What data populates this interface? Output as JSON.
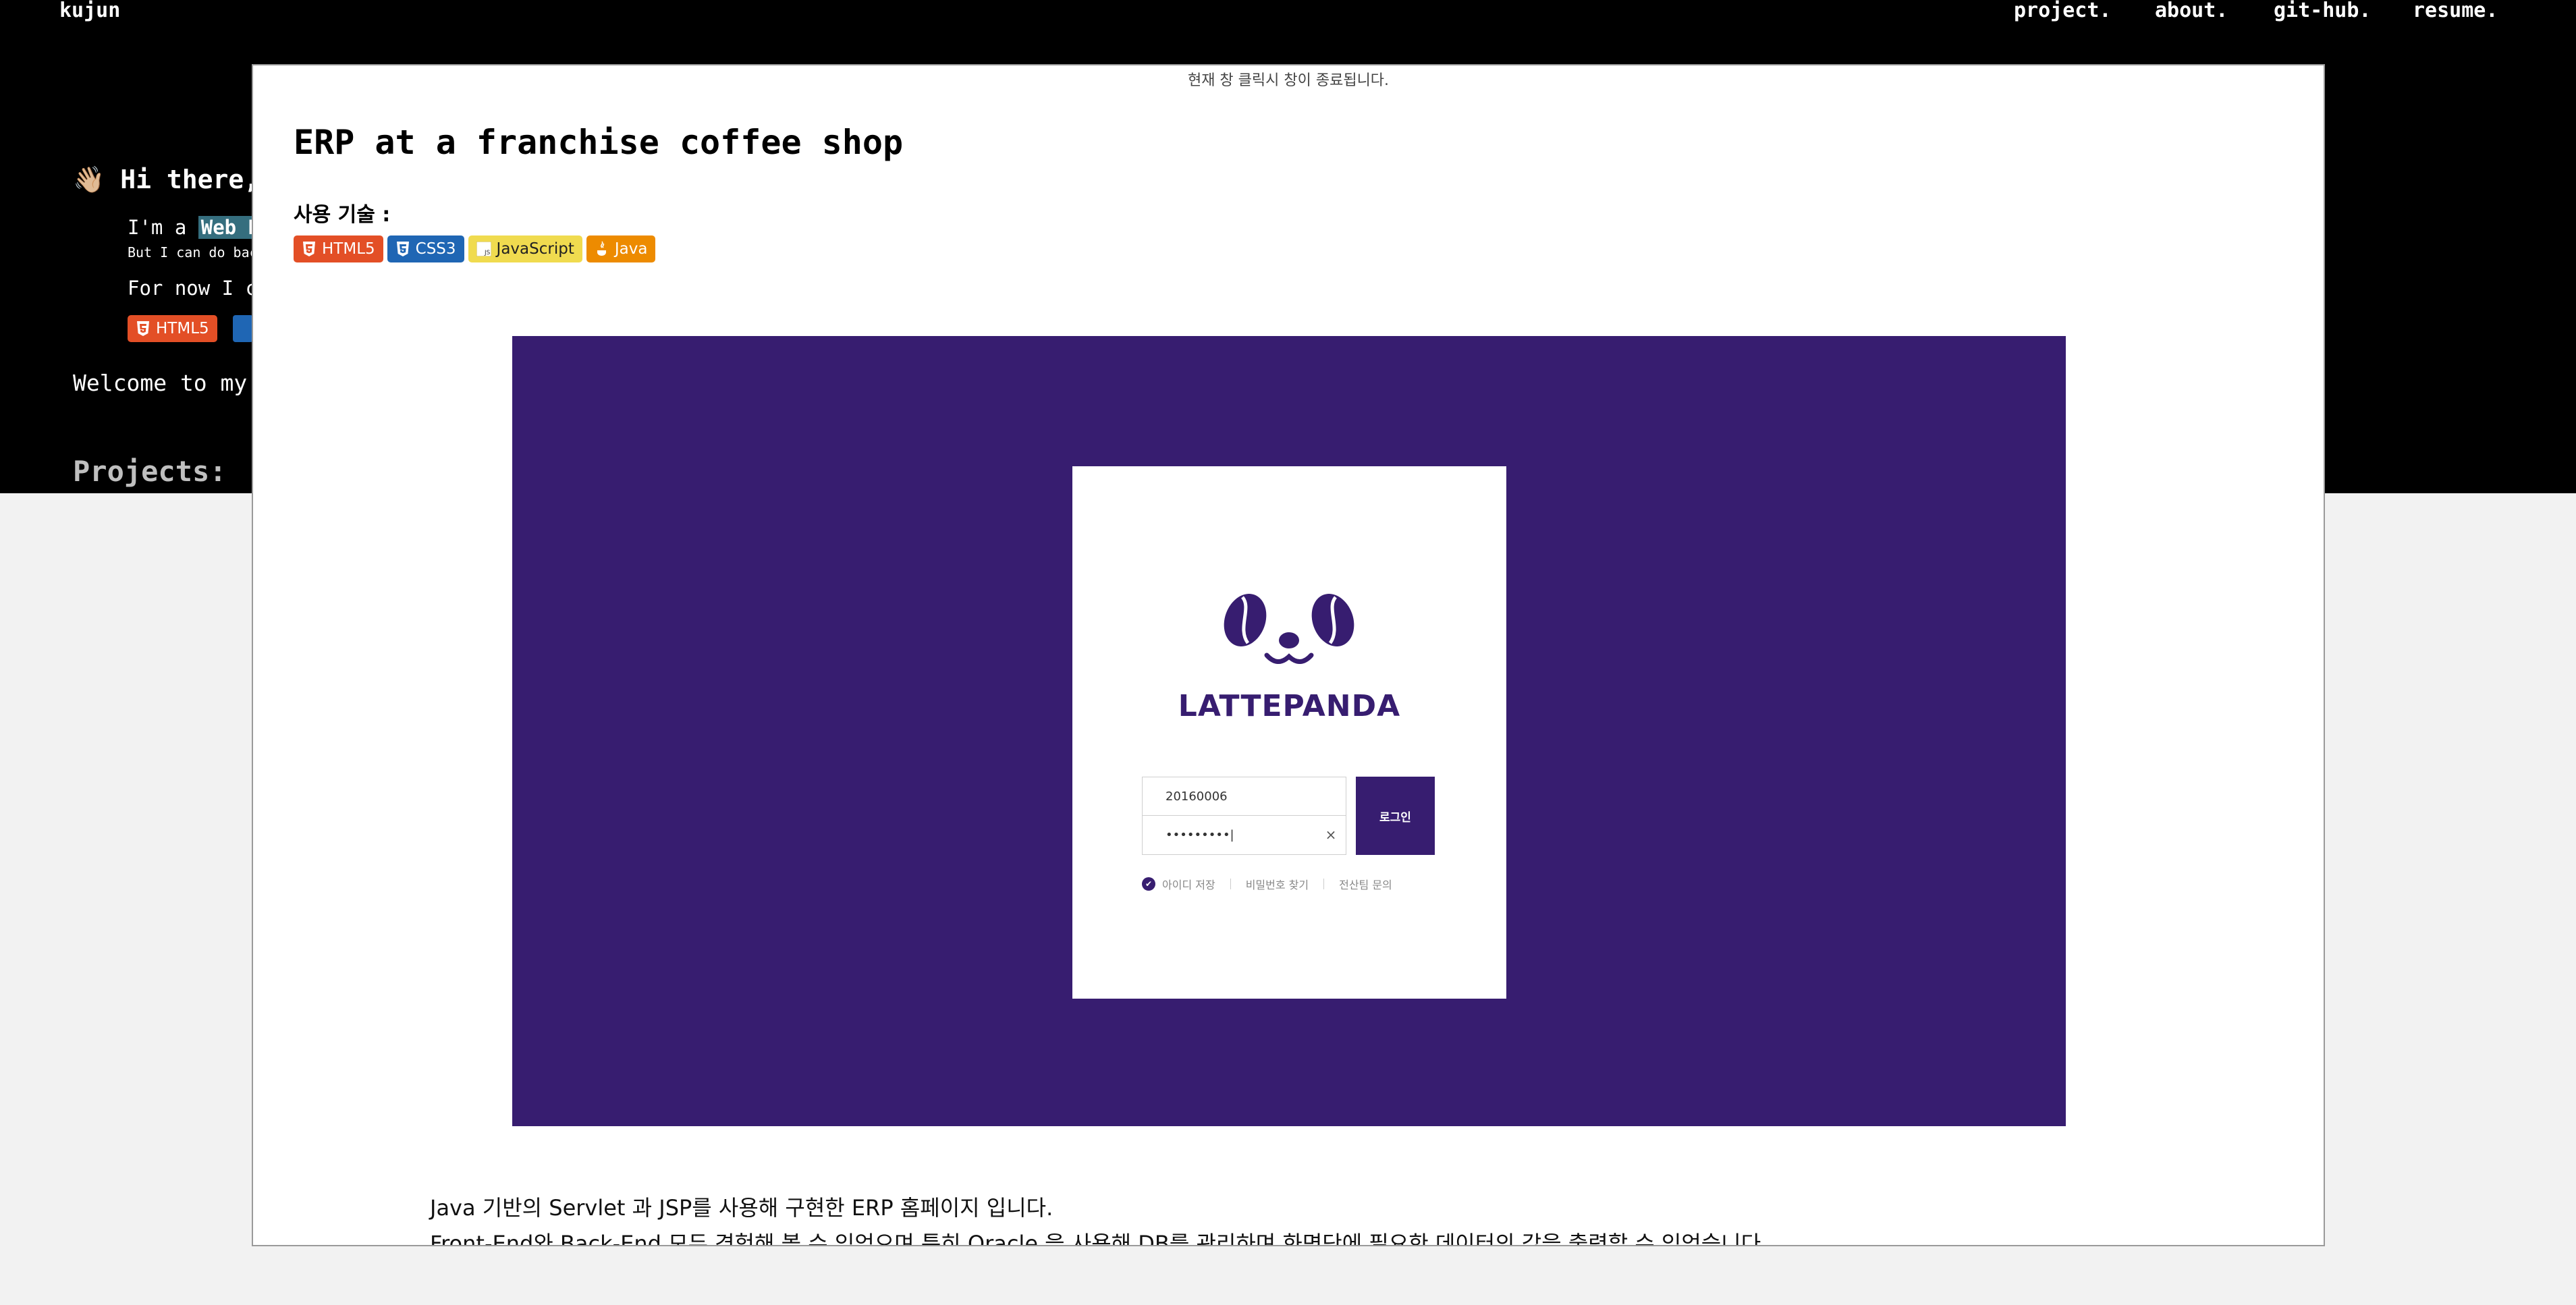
{
  "site": {
    "title": "kujun",
    "nav": [
      "project.",
      "about.",
      "git-hub.",
      "resume."
    ]
  },
  "background": {
    "greeting_emoji": "👋🏼",
    "greeting": "Hi there,",
    "intro_prefix": "I'm a ",
    "intro_highlight": "Web De",
    "intro_small": "But I can do bac",
    "for_now": "For now I ca",
    "badge_html": "HTML5",
    "welcome": "Welcome to my s",
    "projects_heading": "Projects:"
  },
  "modal": {
    "close_hint": "현재 창 클릭시 창이 종료됩니다.",
    "title": "ERP at a franchise coffee shop",
    "tech_label": "사용 기술 :",
    "badges": [
      {
        "label": "HTML5",
        "icon": "html5-icon",
        "color": "#e34f26"
      },
      {
        "label": "CSS3",
        "icon": "css3-icon",
        "color": "#1f66b4"
      },
      {
        "label": "JavaScript",
        "icon": "javascript-icon",
        "color": "#f0db4f"
      },
      {
        "label": "Java",
        "icon": "java-icon",
        "color": "#ed8b00"
      }
    ],
    "preview": {
      "background_color": "#371d70",
      "brand": "LATTEPANDA",
      "id_value": "20160006",
      "password_value": "•••••••••|",
      "clear_icon": "×",
      "login_button": "로그인",
      "save_id": "아이디 저장",
      "find_password": "비밀번호 찾기",
      "it_support": "전산팀 문의"
    },
    "description": [
      "Java 기반의 Servlet 과 JSP를 사용해 구현한 ERP 홈페이지 입니다.",
      "Front-End와 Back-End 모두 경험해 볼 수 있었으며 특히 Oracle 을 사용해 DB를 관리하며 화면단에 필요한 데이터의 값을 출력할 수 있었습니다."
    ]
  }
}
